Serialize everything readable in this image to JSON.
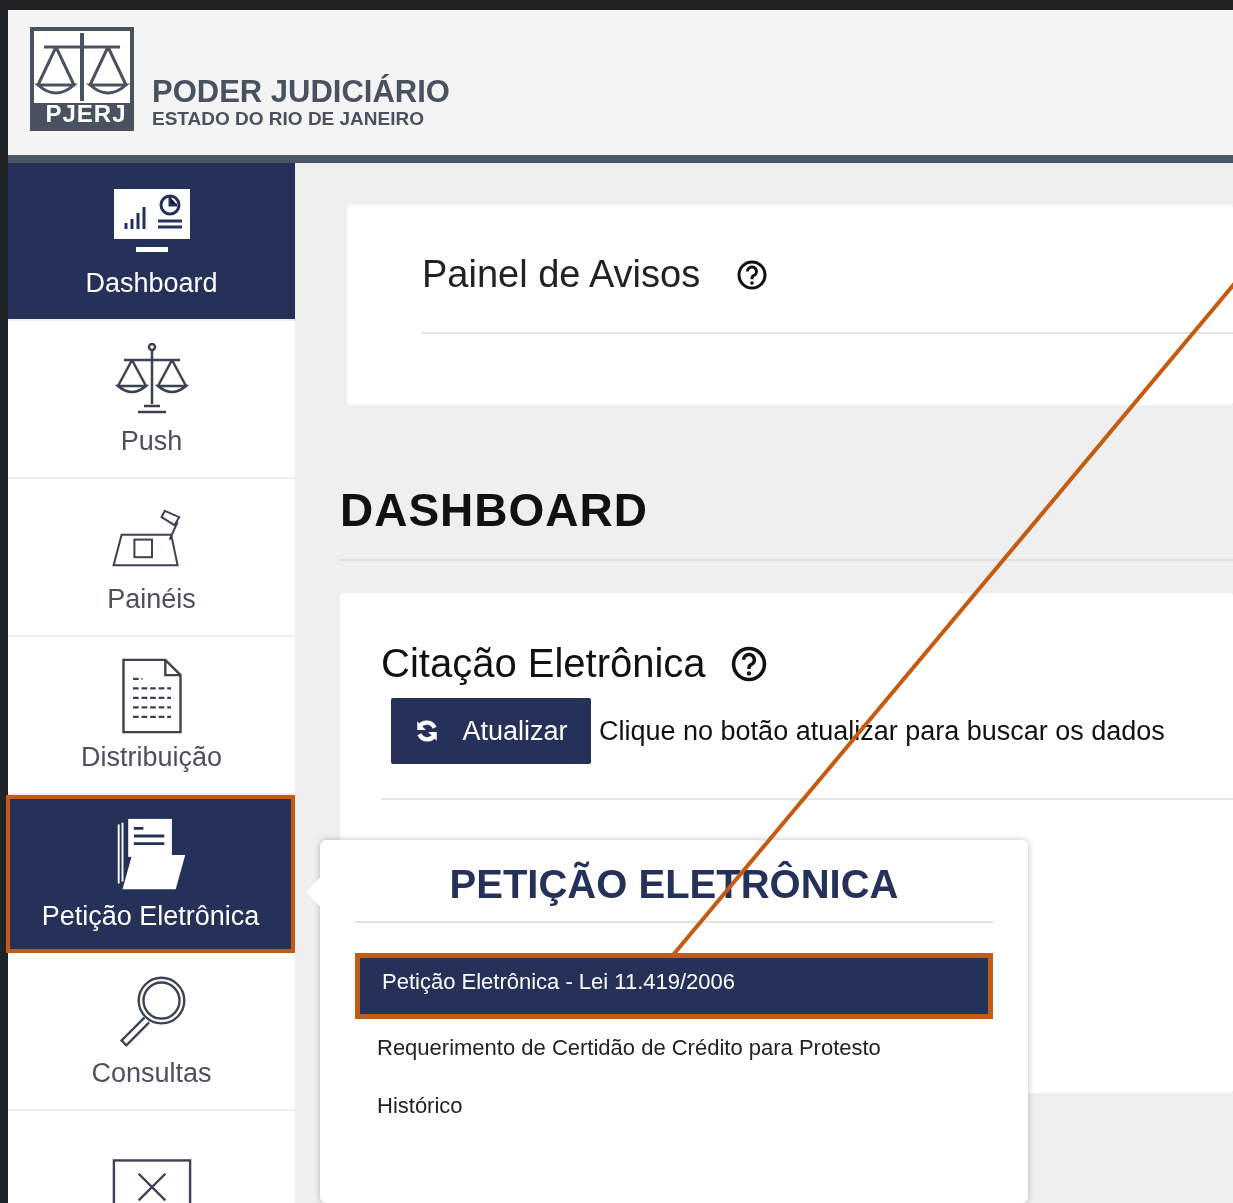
{
  "header": {
    "logo_text": "PJERJ",
    "title": "PODER JUDICIÁRIO",
    "subtitle": "ESTADO DO RIO DE JANEIRO"
  },
  "sidebar": {
    "items": [
      {
        "kind": "dashboard",
        "label": "Dashboard",
        "selected": true,
        "annotated": false
      },
      {
        "kind": "scales",
        "label": "Push",
        "selected": false,
        "annotated": false
      },
      {
        "kind": "desk",
        "label": "Painéis",
        "selected": false,
        "annotated": false
      },
      {
        "kind": "document",
        "label": "Distribuição",
        "selected": false,
        "annotated": false
      },
      {
        "kind": "folder",
        "label": "Petição Eletrônica",
        "selected": true,
        "annotated": true
      },
      {
        "kind": "magnifier",
        "label": "Consultas",
        "selected": false,
        "annotated": false
      },
      {
        "kind": "close",
        "selected": false,
        "annotated": false
      }
    ]
  },
  "notice_panel": {
    "title": "Painel de Avisos"
  },
  "page_title": "DASHBOARD",
  "citation_card": {
    "title": "Citação Eletrônica",
    "button": "Atualizar",
    "hint": "Clique no botão atualizar para buscar os dados"
  },
  "popup_menu": {
    "title": "PETIÇÃO ELETRÔNICA",
    "items": [
      {
        "label": "Petição Eletrônica - Lei 11.419/2006",
        "selected": true,
        "annotated": true
      },
      {
        "label": "Requerimento de Certidão de Crédito para Protesto",
        "selected": false,
        "annotated": false
      },
      {
        "label": "Histórico",
        "selected": false,
        "annotated": false
      }
    ]
  }
}
